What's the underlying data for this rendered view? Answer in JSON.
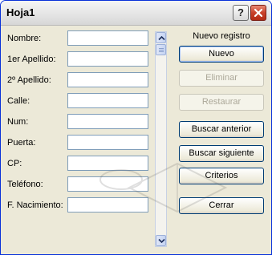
{
  "window": {
    "title": "Hoja1"
  },
  "titlebar": {
    "help_glyph": "?",
    "help_icon": "help-icon",
    "close_icon": "close-icon"
  },
  "form": {
    "fields": [
      {
        "label": "Nombre:",
        "value": ""
      },
      {
        "label": "1er Apellido:",
        "value": ""
      },
      {
        "label": "2º Apellido:",
        "value": ""
      },
      {
        "label": "Calle:",
        "value": ""
      },
      {
        "label": "Num:",
        "value": ""
      },
      {
        "label": "Puerta:",
        "value": ""
      },
      {
        "label": "CP:",
        "value": ""
      },
      {
        "label": "Teléfono:",
        "value": ""
      },
      {
        "label": "F. Nacimiento:",
        "value": ""
      }
    ]
  },
  "record_caption": "Nuevo registro",
  "buttons": [
    {
      "label": "Nuevo",
      "enabled": true,
      "focused": true
    },
    {
      "label": "Eliminar",
      "enabled": false
    },
    {
      "label": "Restaurar",
      "enabled": false
    },
    {
      "label": "Buscar anterior",
      "enabled": true
    },
    {
      "label": "Buscar siguiente",
      "enabled": true
    },
    {
      "label": "Criterios",
      "enabled": true
    },
    {
      "label": "Cerrar",
      "enabled": true
    }
  ],
  "colors": {
    "title_accent": "#0831d9",
    "close_red": "#c8402a",
    "face": "#ece9d8",
    "field_border": "#7f9db9"
  }
}
